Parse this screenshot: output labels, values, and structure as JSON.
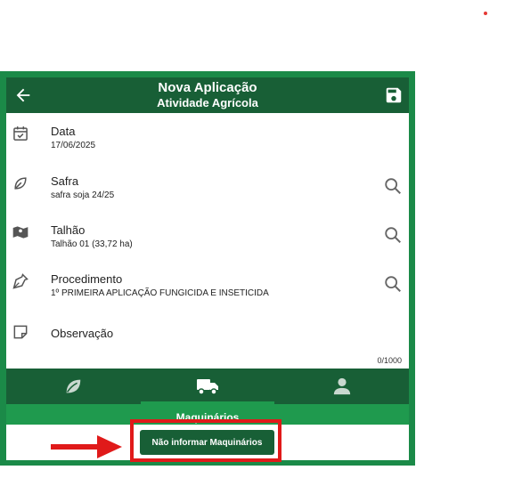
{
  "app_bar": {
    "title": "Nova Aplicação",
    "subtitle": "Atividade Agrícola"
  },
  "fields": {
    "data": {
      "label": "Data",
      "value": "17/06/2025"
    },
    "safra": {
      "label": "Safra",
      "value": "safra soja 24/25"
    },
    "talhao": {
      "label": "Talhão",
      "value": "Talhão 01 (33,72 ha)"
    },
    "procedimento": {
      "label": "Procedimento",
      "value": "1º PRIMEIRA APLICAÇÃO FUNGICIDA E INSETICIDA"
    },
    "observacao": {
      "label": "Observação",
      "counter": "0/1000"
    }
  },
  "tabs": [
    {
      "icon": "leaf-icon",
      "active": false
    },
    {
      "icon": "truck-icon",
      "active": true
    },
    {
      "icon": "person-icon",
      "active": false
    }
  ],
  "section": {
    "title": "Maquinários"
  },
  "actions": {
    "skip_machinery_label": "Não informar Maquinários"
  },
  "colors": {
    "primary_dark": "#185f36",
    "primary": "#1f9a4e",
    "highlight": "#e01a1a"
  }
}
